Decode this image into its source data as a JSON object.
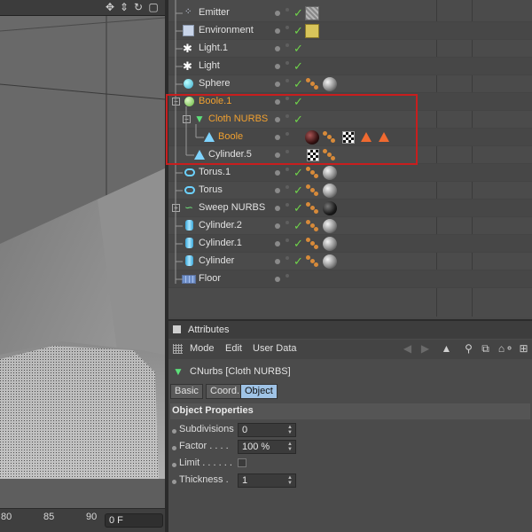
{
  "viewport": {
    "timeline": {
      "ticks": [
        "80",
        "85",
        "90"
      ],
      "frame": "0 F"
    }
  },
  "object_manager": {
    "rows": [
      {
        "name": "Emitter",
        "icon": "emitter-icon"
      },
      {
        "name": "Environment",
        "icon": "environment-icon"
      },
      {
        "name": "Light.1",
        "icon": "light-icon"
      },
      {
        "name": "Light",
        "icon": "light-icon"
      },
      {
        "name": "Sphere",
        "icon": "sphere-icon"
      },
      {
        "name": "Boole.1",
        "icon": "boole-icon",
        "color": "#f0a030"
      },
      {
        "name": "Cloth NURBS",
        "icon": "cloth-nurbs-icon",
        "color": "#f0a030"
      },
      {
        "name": "Boole",
        "icon": "boole-icon",
        "color": "#f0a030"
      },
      {
        "name": "Cylinder.5",
        "icon": "cylinder-icon"
      },
      {
        "name": "Torus.1",
        "icon": "torus-icon"
      },
      {
        "name": "Torus",
        "icon": "torus-icon"
      },
      {
        "name": "Sweep NURBS",
        "icon": "sweep-nurbs-icon"
      },
      {
        "name": "Cylinder.2",
        "icon": "cylinder-icon"
      },
      {
        "name": "Cylinder.1",
        "icon": "cylinder-icon"
      },
      {
        "name": "Cylinder",
        "icon": "cylinder-icon"
      },
      {
        "name": "Floor",
        "icon": "floor-icon"
      }
    ],
    "check_mark": "✓"
  },
  "attributes": {
    "title": "Attributes",
    "menu": [
      "Mode",
      "Edit",
      "User Data"
    ],
    "object_name": "CNurbs [Cloth NURBS]",
    "tabs": [
      "Basic",
      "Coord.",
      "Object"
    ],
    "active_tab": "Object",
    "section": "Object Properties",
    "properties": [
      {
        "label": "Subdivisions",
        "value": "0"
      },
      {
        "label": "Factor . . . .",
        "value": "100 %"
      },
      {
        "label": "Limit . . . . . .",
        "value": ""
      },
      {
        "label": "Thickness  .",
        "value": "1"
      }
    ]
  }
}
